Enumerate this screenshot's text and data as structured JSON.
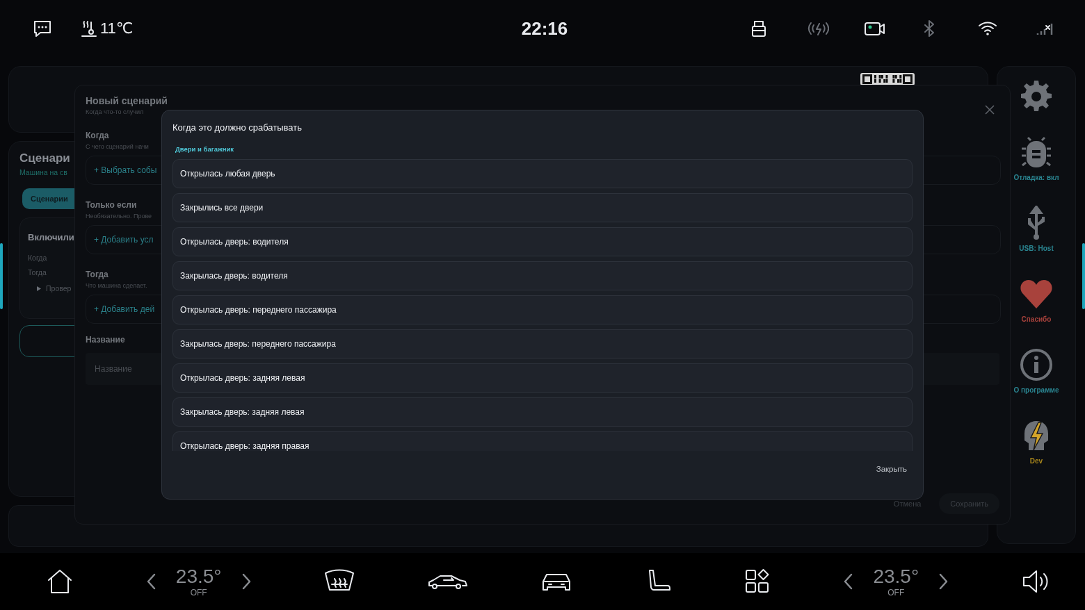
{
  "status_bar": {
    "temperature": "11℃",
    "time": "22:16",
    "indicators": [
      {
        "kind": "usb",
        "active": true
      },
      {
        "kind": "charging",
        "active": false
      },
      {
        "kind": "camera",
        "active": true
      },
      {
        "kind": "bluetooth",
        "active": false
      },
      {
        "kind": "wifi",
        "active": true
      },
      {
        "kind": "signal",
        "active": true
      }
    ]
  },
  "scenarios_panel": {
    "title": "Сценари",
    "subtitle": "Машина на св",
    "tab": "Сценарии",
    "card": {
      "title": "Включили",
      "rows": [
        "Когда",
        "Тогда"
      ],
      "expander": "Провер"
    }
  },
  "sidebar": {
    "items": [
      {
        "kind": "gear"
      },
      {
        "kind": "bug",
        "label": "Отладка: вкл",
        "color": "#2a8591"
      },
      {
        "kind": "usb",
        "label": "USB: Host",
        "color": "#2a8591"
      },
      {
        "kind": "heart",
        "label": "Спасибо",
        "color": "#a8423c"
      },
      {
        "kind": "info",
        "label": "О программе",
        "color": "#2a8591"
      },
      {
        "kind": "dev",
        "label": "Dev",
        "color": "#a8861c"
      }
    ]
  },
  "new_scenario": {
    "title": "Новый сценарий",
    "subtitle": "Когда что-то случил",
    "sections": [
      {
        "title": "Когда",
        "hint": "С чего сценарий начи",
        "action": "+  Выбрать собы"
      },
      {
        "title": "Только если",
        "hint": "Необязательно. Прове",
        "action": "+  Добавить усл"
      },
      {
        "title": "Тогда",
        "hint": "Что машина сделает.",
        "action": "+  Добавить дей"
      }
    ],
    "name_label": "Название",
    "name_field": {
      "placeholder": "Название"
    },
    "buttons": [
      "Отмена",
      "Сохранить"
    ]
  },
  "trigger_dialog": {
    "title": "Когда это должно срабатывать",
    "category": "Двери и багажник",
    "options": [
      "Открылась любая дверь",
      "Закрылись все двери",
      "Открылась дверь: водителя",
      "Закрылась дверь: водителя",
      "Открылась дверь: переднего пассажира",
      "Закрылась дверь: переднего пассажира",
      "Открылась дверь: задняя левая",
      "Закрылась дверь: задняя левая",
      "Открылась дверь: задняя правая"
    ],
    "close_button": "Закрыть"
  },
  "bottom_bar": {
    "left_climate": {
      "temperature": "23.5°",
      "mode": "OFF"
    },
    "right_climate": {
      "temperature": "23.5°",
      "mode": "OFF"
    }
  }
}
